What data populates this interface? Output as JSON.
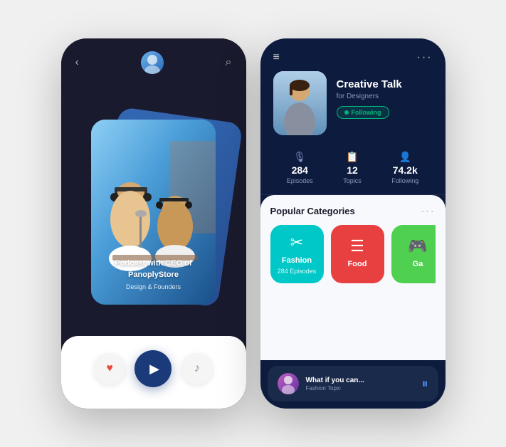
{
  "left_phone": {
    "header": {
      "back_label": "‹",
      "search_label": "⌕"
    },
    "card": {
      "title": "Podcast with CEO of PanoplyStore",
      "subtitle": "Design & Founders"
    },
    "controls": {
      "like_icon": "♥",
      "play_icon": "▶",
      "music_icon": "♪"
    }
  },
  "right_phone": {
    "header": {
      "hamburger_label": "≡",
      "dots_label": "···"
    },
    "profile": {
      "name": "Creative Talk",
      "subtitle": "for Designers",
      "following_label": "Following"
    },
    "stats": [
      {
        "icon": "🎙",
        "value": "284",
        "label": "Episodes"
      },
      {
        "icon": "📋",
        "value": "12",
        "label": "Topics"
      },
      {
        "icon": "👤",
        "value": "74.2k",
        "label": "Following"
      }
    ],
    "categories": {
      "title": "Popular Categories",
      "items": [
        {
          "icon": "✂",
          "name": "Fashion",
          "episodes": "284 Episodes",
          "color": "cyan"
        },
        {
          "icon": "☰",
          "name": "Food",
          "episodes": "",
          "color": "red"
        },
        {
          "icon": "🎮",
          "name": "Ga",
          "episodes": "",
          "color": "green"
        }
      ]
    },
    "player": {
      "title": "What if you can...",
      "subtitle": "Fashion Topic",
      "pause_icon": "⏸"
    }
  }
}
